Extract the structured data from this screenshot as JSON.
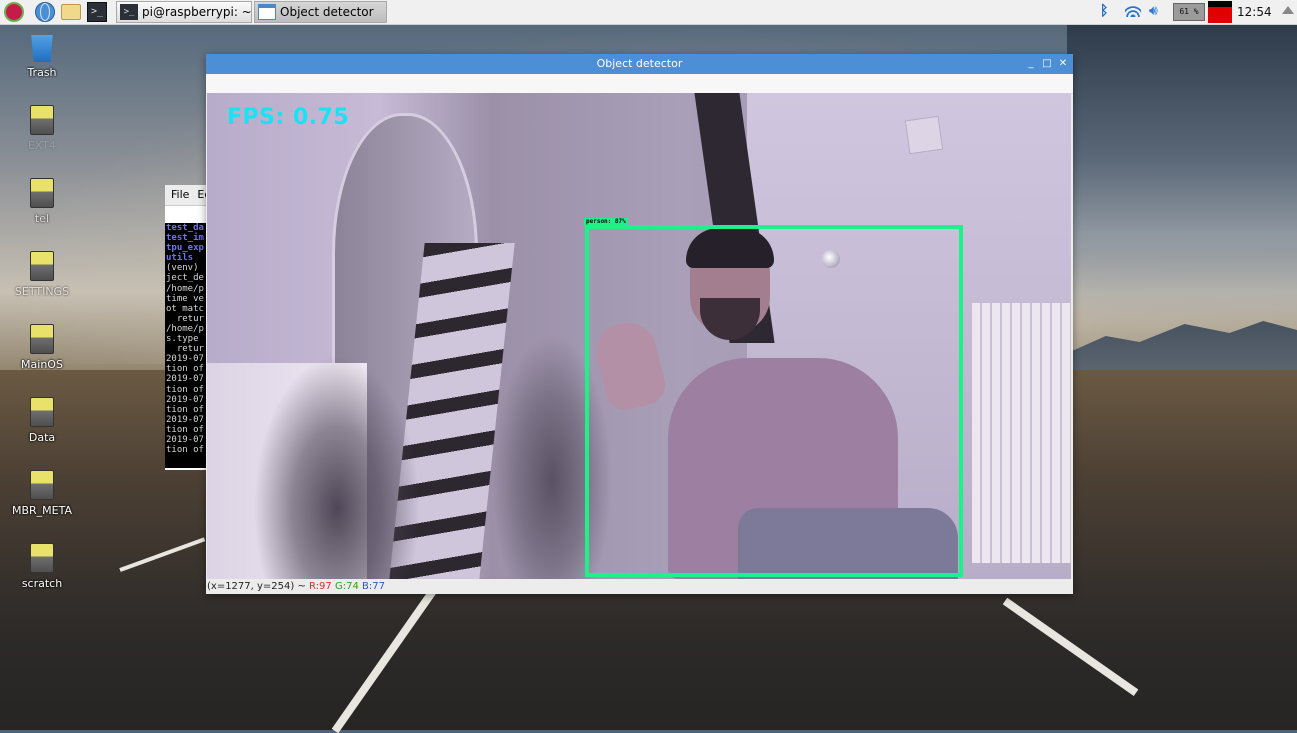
{
  "taskbar": {
    "tasks": [
      {
        "label": "pi@raspberrypi: ~/ten..."
      },
      {
        "label": "Object detector"
      }
    ],
    "cpu_label": "61 %",
    "clock": "12:54"
  },
  "desktop_icons": [
    {
      "label": "Trash"
    },
    {
      "label": "EXT4"
    },
    {
      "label": "tel"
    },
    {
      "label": "SETTINGS"
    },
    {
      "label": "MainOS"
    },
    {
      "label": "Data"
    },
    {
      "label": "MBR_META"
    },
    {
      "label": "scratch"
    }
  ],
  "terminal": {
    "menu": [
      "File",
      "Ed"
    ],
    "lines": [
      {
        "text": "test_da",
        "hl": true
      },
      {
        "text": "test_im",
        "hl": true
      },
      {
        "text": "tpu_exp",
        "hl": true
      },
      {
        "text": "utils",
        "hl": true
      },
      {
        "text": "(venv)",
        "hl": false
      },
      {
        "text": "ject_de",
        "hl": false
      },
      {
        "text": "/home/p",
        "hl": false
      },
      {
        "text": "time ve",
        "hl": false
      },
      {
        "text": "ot matc",
        "hl": false
      },
      {
        "text": "  retur",
        "hl": false
      },
      {
        "text": "/home/p",
        "hl": false
      },
      {
        "text": "s.type",
        "hl": false
      },
      {
        "text": "  retur",
        "hl": false
      },
      {
        "text": "2019-07",
        "hl": false
      },
      {
        "text": "tion of",
        "hl": false
      },
      {
        "text": "2019-07",
        "hl": false
      },
      {
        "text": "tion of",
        "hl": false
      },
      {
        "text": "2019-07",
        "hl": false
      },
      {
        "text": "tion of",
        "hl": false
      },
      {
        "text": "2019-07",
        "hl": false
      },
      {
        "text": "tion of",
        "hl": false
      },
      {
        "text": "2019-07",
        "hl": false
      },
      {
        "text": "tion of",
        "hl": false
      }
    ]
  },
  "window": {
    "title": "Object detector",
    "controls": {
      "minimize": "_",
      "maximize": "□",
      "close": "✕"
    },
    "fps": "FPS: 0.75",
    "detection_label": "person: 87%",
    "status": {
      "coords": "(x=1277, y=254) ~",
      "r": "R:97",
      "g": "G:74",
      "b": "B:77"
    }
  }
}
